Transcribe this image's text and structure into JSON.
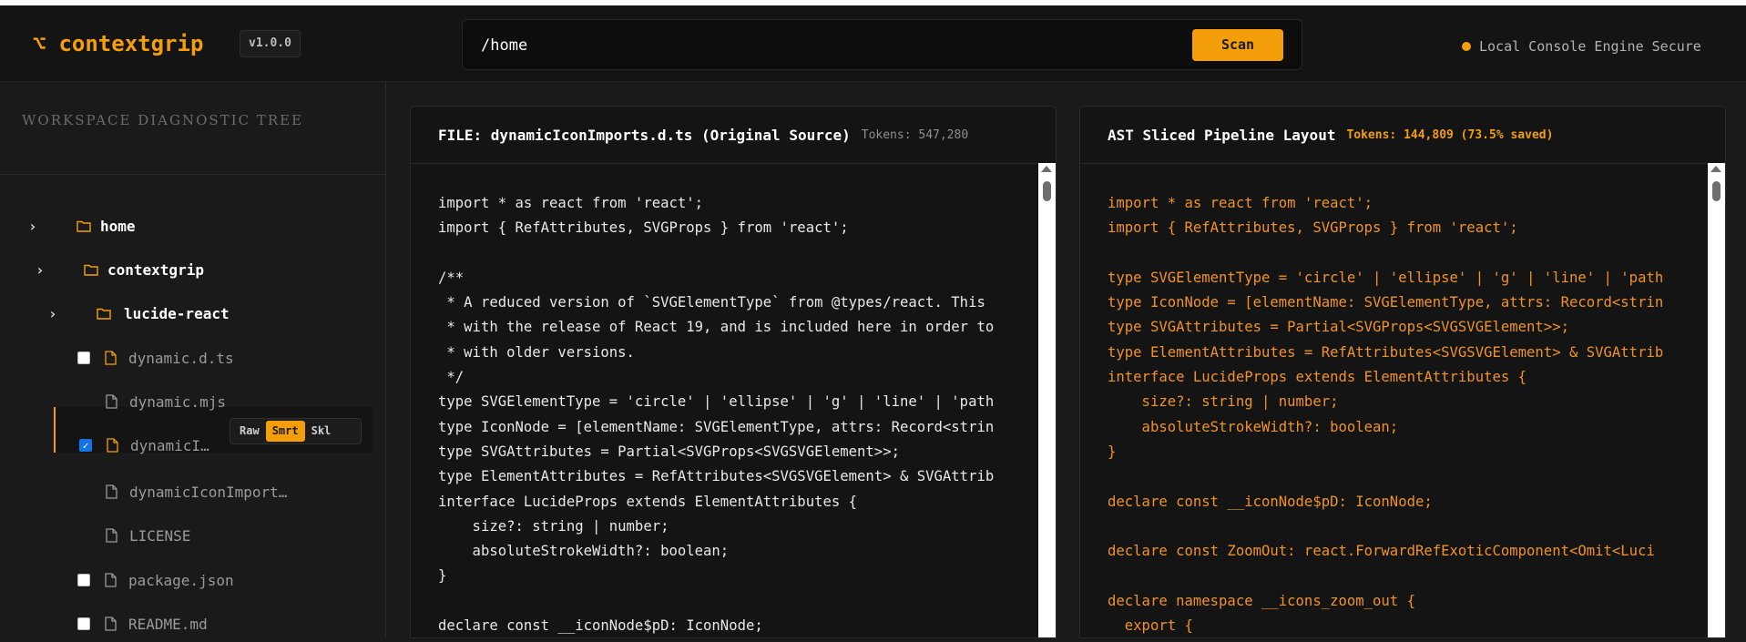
{
  "app": {
    "name": "contextgrip",
    "version": "v1.0.0",
    "logo_glyph": "⌥",
    "accent": "#f59e0b"
  },
  "pathbar": {
    "value": "/home",
    "scan_label": "Scan"
  },
  "status": {
    "text": "Local Console Engine Secure",
    "dot_color": "#f59e0b"
  },
  "sidebar": {
    "heading": "WORKSPACE DIAGNOSTIC TREE",
    "folders": [
      {
        "label": "home"
      },
      {
        "label": "contextgrip"
      },
      {
        "label": "lucide-react"
      }
    ],
    "files": [
      {
        "label": "dynamic.d.ts",
        "has_checkbox": true,
        "checked": false
      },
      {
        "label": "dynamic.mjs",
        "has_checkbox": false,
        "checked": false
      },
      {
        "label": "dynamicI…",
        "has_checkbox": true,
        "checked": true,
        "selected": true
      },
      {
        "label": "dynamicIconImport…",
        "has_checkbox": false,
        "checked": false
      },
      {
        "label": "LICENSE",
        "has_checkbox": false,
        "checked": false
      },
      {
        "label": "package.json",
        "has_checkbox": true,
        "checked": false
      },
      {
        "label": "README.md",
        "has_checkbox": true,
        "checked": false
      }
    ],
    "mode_toggle": {
      "options": [
        "Raw",
        "Smrt",
        "Skl"
      ],
      "active": "Smrt"
    }
  },
  "panels": {
    "original": {
      "title": "FILE: dynamicIconImports.d.ts (Original Source)",
      "tokens": "Tokens: 547,280",
      "lines": [
        "import * as react from 'react';",
        "import { RefAttributes, SVGProps } from 'react';",
        "",
        "/**",
        " * A reduced version of `SVGElementType` from @types/react. This",
        " * with the release of React 19, and is included here in order to",
        " * with older versions.",
        " */",
        "type SVGElementType = 'circle' | 'ellipse' | 'g' | 'line' | 'path",
        "type IconNode = [elementName: SVGElementType, attrs: Record<strin",
        "type SVGAttributes = Partial<SVGProps<SVGSVGElement>>;",
        "type ElementAttributes = RefAttributes<SVGSVGElement> & SVGAttrib",
        "interface LucideProps extends ElementAttributes {",
        "    size?: string | number;",
        "    absoluteStrokeWidth?: boolean;",
        "}",
        "",
        "declare const __iconNode$pD: IconNode;"
      ]
    },
    "sliced": {
      "title": "AST Sliced Pipeline Layout",
      "tokens": "Tokens: 144,809 (73.5% saved)",
      "lines": [
        "import * as react from 'react';",
        "import { RefAttributes, SVGProps } from 'react';",
        "",
        "type SVGElementType = 'circle' | 'ellipse' | 'g' | 'line' | 'path",
        "type IconNode = [elementName: SVGElementType, attrs: Record<strin",
        "type SVGAttributes = Partial<SVGProps<SVGSVGElement>>;",
        "type ElementAttributes = RefAttributes<SVGSVGElement> & SVGAttrib",
        "interface LucideProps extends ElementAttributes {",
        "    size?: string | number;",
        "    absoluteStrokeWidth?: boolean;",
        "}",
        "",
        "declare const __iconNode$pD: IconNode;",
        "",
        "declare const ZoomOut: react.ForwardRefExoticComponent<Omit<Luci",
        "",
        "declare namespace __icons_zoom_out {",
        "  export {"
      ]
    }
  }
}
